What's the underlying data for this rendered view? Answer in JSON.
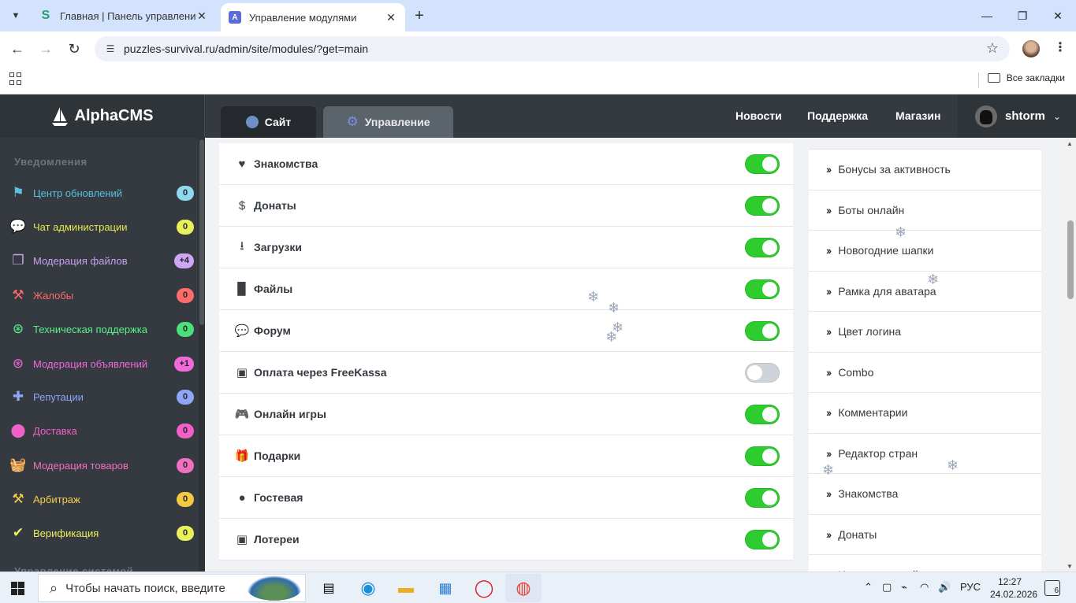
{
  "browser": {
    "tabs": [
      {
        "title": "Главная | Панель управления",
        "favicon": "S"
      },
      {
        "title": "Управление модулями",
        "favicon": "A"
      }
    ],
    "url": "puzzles-survival.ru/admin/site/modules/?get=main",
    "bookmarks_all": "Все закладки"
  },
  "header": {
    "brand": "AlphaCMS",
    "tab_site": "Сайт",
    "tab_manage": "Управление",
    "nav": [
      "Новости",
      "Поддержка",
      "Магазин"
    ],
    "username": "shtorm"
  },
  "sidebar": {
    "heading": "Уведомления",
    "heading2": "Управление системой",
    "items": [
      {
        "label": "Центр обновлений",
        "badge": "0",
        "color": "#5bc0de",
        "badge_bg": "#8fd8f0",
        "icon": "flag-icon",
        "glyph": "⚑"
      },
      {
        "label": "Чат администрации",
        "badge": "0",
        "color": "#e6e94a",
        "badge_bg": "#eaf05c",
        "icon": "chat-icon",
        "glyph": "💬"
      },
      {
        "label": "Модерация файлов",
        "badge": "+4",
        "color": "#c9a0f0",
        "badge_bg": "#cfa6f5",
        "icon": "files-icon",
        "glyph": "❐"
      },
      {
        "label": "Жалобы",
        "badge": "0",
        "color": "#ff6b6b",
        "badge_bg": "#ff6b6b",
        "icon": "gavel-icon",
        "glyph": "⚒"
      },
      {
        "label": "Техническая поддержка",
        "badge": "0",
        "color": "#5cf08a",
        "badge_bg": "#4de07a",
        "icon": "lifebuoy-icon",
        "glyph": "⊛"
      },
      {
        "label": "Модерация объявлений",
        "badge": "+1",
        "color": "#f06ad8",
        "badge_bg": "#f06ad8",
        "icon": "lifebuoy-icon",
        "glyph": "⊛"
      },
      {
        "label": "Репутации",
        "badge": "0",
        "color": "#8fa5f5",
        "badge_bg": "#8fa5f5",
        "icon": "plus-icon",
        "glyph": "✚"
      },
      {
        "label": "Доставка",
        "badge": "0",
        "color": "#f060c8",
        "badge_bg": "#f060c8",
        "icon": "map-pin-icon",
        "glyph": "⬤"
      },
      {
        "label": "Модерация товаров",
        "badge": "0",
        "color": "#f070c0",
        "badge_bg": "#f070c0",
        "icon": "basket-icon",
        "glyph": "🧺"
      },
      {
        "label": "Арбитраж",
        "badge": "0",
        "color": "#f5d04a",
        "badge_bg": "#f5c842",
        "icon": "gavel-icon",
        "glyph": "⚒"
      },
      {
        "label": "Верификация",
        "badge": "0",
        "color": "#eaf05c",
        "badge_bg": "#eaf05c",
        "icon": "check-icon",
        "glyph": "✔"
      }
    ]
  },
  "modules": [
    {
      "label": "Знакомства",
      "icon": "heart-icon",
      "glyph": "♥",
      "enabled": true
    },
    {
      "label": "Донаты",
      "icon": "dollar-icon",
      "glyph": "$",
      "enabled": true
    },
    {
      "label": "Загрузки",
      "icon": "download-icon",
      "glyph": "⭳",
      "enabled": true
    },
    {
      "label": "Файлы",
      "icon": "file-icon",
      "glyph": "▉",
      "enabled": true
    },
    {
      "label": "Форум",
      "icon": "comments-icon",
      "glyph": "💬",
      "enabled": true
    },
    {
      "label": "Оплата через FreeKassa",
      "icon": "money-icon",
      "glyph": "▣",
      "enabled": false
    },
    {
      "label": "Онлайн игры",
      "icon": "gamepad-icon",
      "glyph": "🎮",
      "enabled": true
    },
    {
      "label": "Подарки",
      "icon": "gift-icon",
      "glyph": "🎁",
      "enabled": true
    },
    {
      "label": "Гостевая",
      "icon": "comment-icon",
      "glyph": "●",
      "enabled": true
    },
    {
      "label": "Лотереи",
      "icon": "money-icon",
      "glyph": "▣",
      "enabled": true
    }
  ],
  "right_list": [
    "Бонусы за активность",
    "Боты онлайн",
    "Новогодние шапки",
    "Рамка для аватара",
    "Цвет логина",
    "Combo",
    "Комментарии",
    "Редактор стран",
    "Знакомства",
    "Донаты",
    "Игровые на сайт"
  ],
  "taskbar": {
    "search_placeholder": "Чтобы начать поиск, введите",
    "lang": "РУС",
    "time": "12:27",
    "date": "24.02.2026",
    "notifications": "6"
  }
}
